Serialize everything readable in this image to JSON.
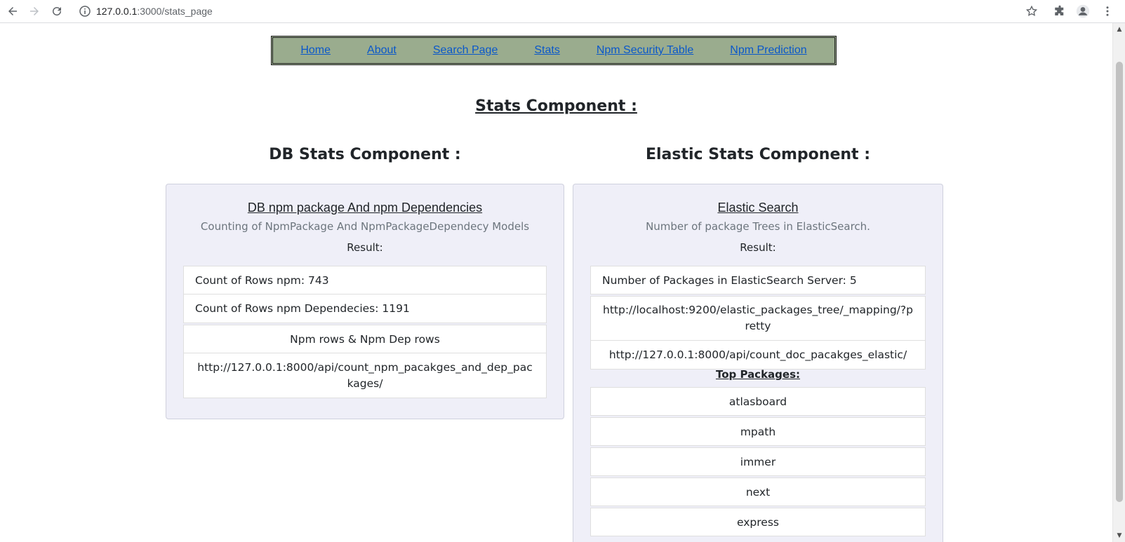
{
  "browser": {
    "url_host": "127.0.0.1",
    "url_path": ":3000/stats_page"
  },
  "nav": {
    "items": [
      "Home",
      "About",
      "Search Page",
      "Stats",
      "Npm Security Table",
      "Npm Prediction"
    ]
  },
  "page": {
    "title": "Stats Component :"
  },
  "db": {
    "section_title": "DB Stats Component :",
    "card_title": "DB npm package And npm Dependencies",
    "subtitle": "Counting of NpmPackage And NpmPackageDependecy Models",
    "result_label": "Result:",
    "rows": [
      "Count of Rows npm: 743",
      "Count of Rows npm Dependecies: 1191"
    ],
    "footer_label": "Npm rows & Npm Dep rows",
    "endpoint": "http://127.0.0.1:8000/api/count_npm_pacakges_and_dep_packages/"
  },
  "elastic": {
    "section_title": "Elastic Stats Component :",
    "card_title": "Elastic Search",
    "subtitle": "Number of package Trees in ElasticSearch.",
    "result_label": "Result:",
    "count_row": "Number of Packages in ElasticSearch Server: 5",
    "mapping_url": "http://localhost:9200/elastic_packages_tree/_mapping/?pretty",
    "endpoint": "http://127.0.0.1:8000/api/count_doc_pacakges_elastic/",
    "top_label": "Top Packages:",
    "top_packages": [
      "atlasboard",
      "mpath",
      "immer",
      "next",
      "express"
    ]
  }
}
